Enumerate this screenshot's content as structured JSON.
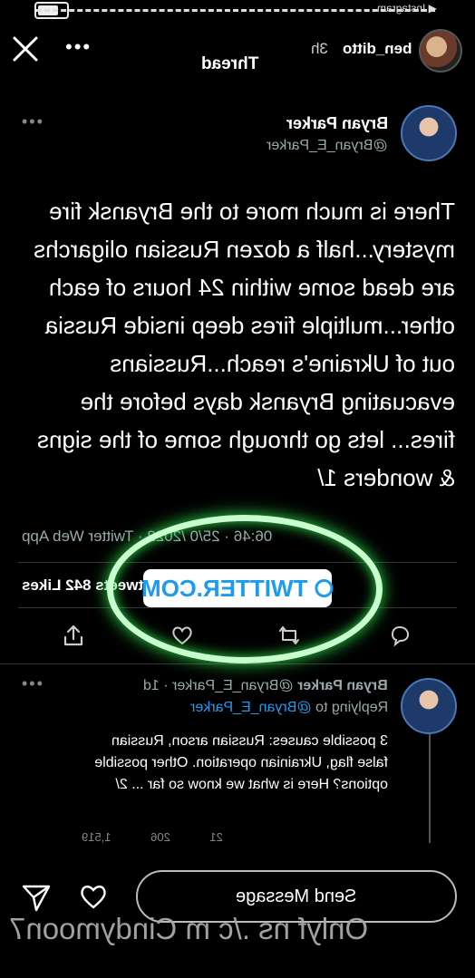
{
  "status_bar": {
    "app_back": "◀ Instagram"
  },
  "story_header": {
    "username": "ben_ditto",
    "age": "3h",
    "thread_title": "Thread",
    "more": "•••"
  },
  "tweet": {
    "name": "Bryan Parker",
    "handle": "@Bryan_E_Parker",
    "more": "•••",
    "body": "There is much more to the Bryansk fire mystery...half a dozen Russian oligarchs are dead some within 24 hours of each other...multiple fires deep inside Russia out of Ukraine's reach...Russians evacuating Bryansk days before the fires... lets go through some of the signs & wonders 1/",
    "meta": "06:46 · 25/0 /2022 · Twitter Web App",
    "stats": "2,625 Retweets  842 Likes"
  },
  "link_sticker": {
    "label": "TWITTER.COM"
  },
  "reply": {
    "name": "Bryan Parker",
    "handle_time": "@Bryan_E_Parker · 1d",
    "replying_prefix": "Replying to",
    "replying_handle": "@Bryan_E_Parker",
    "body": "3 possible causes: Russian arson, Russian false flag, Ukrainian operation. Other possible options? Here is what we know so far ... 2/",
    "more": "•••",
    "stats": "21 206 1,519"
  },
  "bottom": {
    "message_placeholder": "Send Message",
    "watermark": "Onlyf ns ./c m Cindymoon7"
  },
  "colors": {
    "accent": "#1d9bf0",
    "ring_glow": "#2fdc4c",
    "background": "#000000"
  }
}
